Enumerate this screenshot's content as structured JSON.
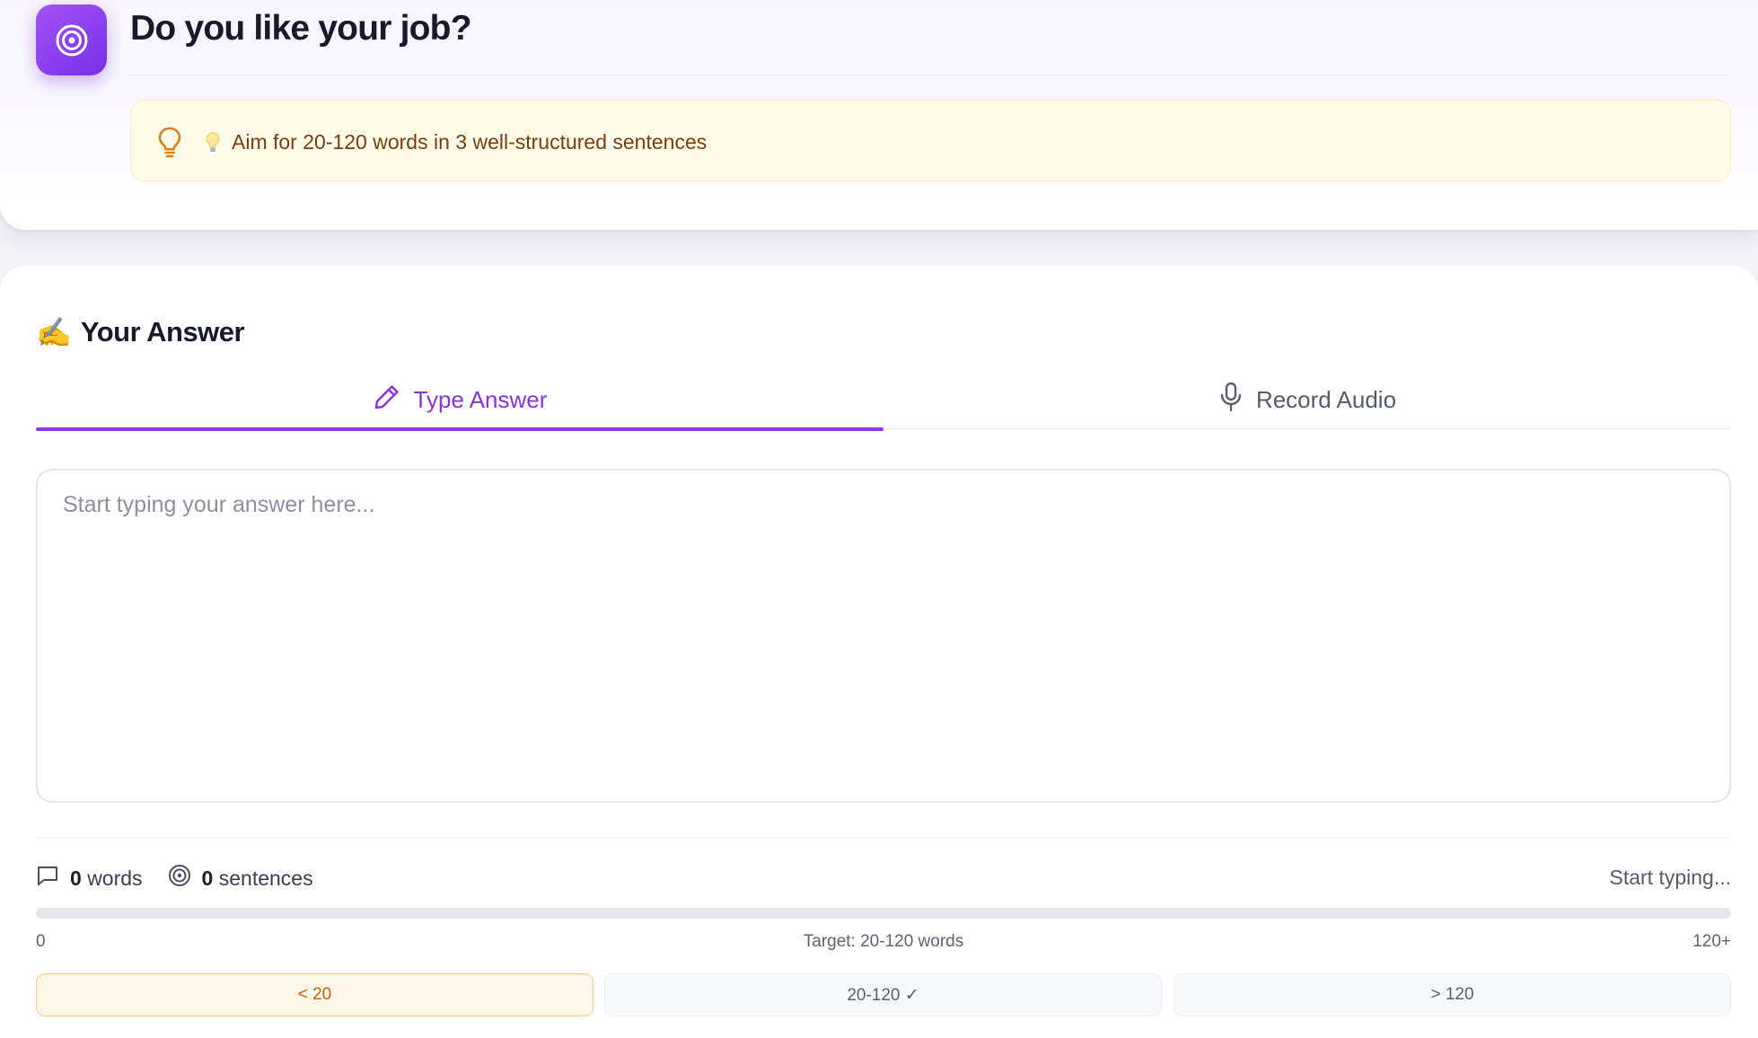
{
  "question": {
    "title": "Do you like your job?",
    "tip_text": "Aim for 20-120 words in 3 well-structured sentences"
  },
  "answer": {
    "heading_emoji": "✍️",
    "heading": "Your Answer",
    "tabs": [
      {
        "label": "Type Answer",
        "icon": "pencil-icon",
        "active": true
      },
      {
        "label": "Record Audio",
        "icon": "microphone-icon",
        "active": false
      }
    ],
    "input": {
      "value": "",
      "placeholder": "Start typing your answer here..."
    },
    "stats": {
      "word_count": "0",
      "word_label": "words",
      "sentence_count": "0",
      "sentence_label": "sentences",
      "status": "Start typing..."
    },
    "progress": {
      "fraction": 0,
      "min_label": "0",
      "target_label": "Target: 20-120 words",
      "max_label": "120+"
    },
    "ranges": [
      {
        "label": "< 20",
        "active": true
      },
      {
        "label": "20-120 ✓",
        "active": false
      },
      {
        "label": "> 120",
        "active": false
      }
    ]
  },
  "colors": {
    "accent": "#8a33e0",
    "tip_background": "#fffbe9",
    "tip_text": "#7a3d10",
    "warning": "#c2610f"
  }
}
